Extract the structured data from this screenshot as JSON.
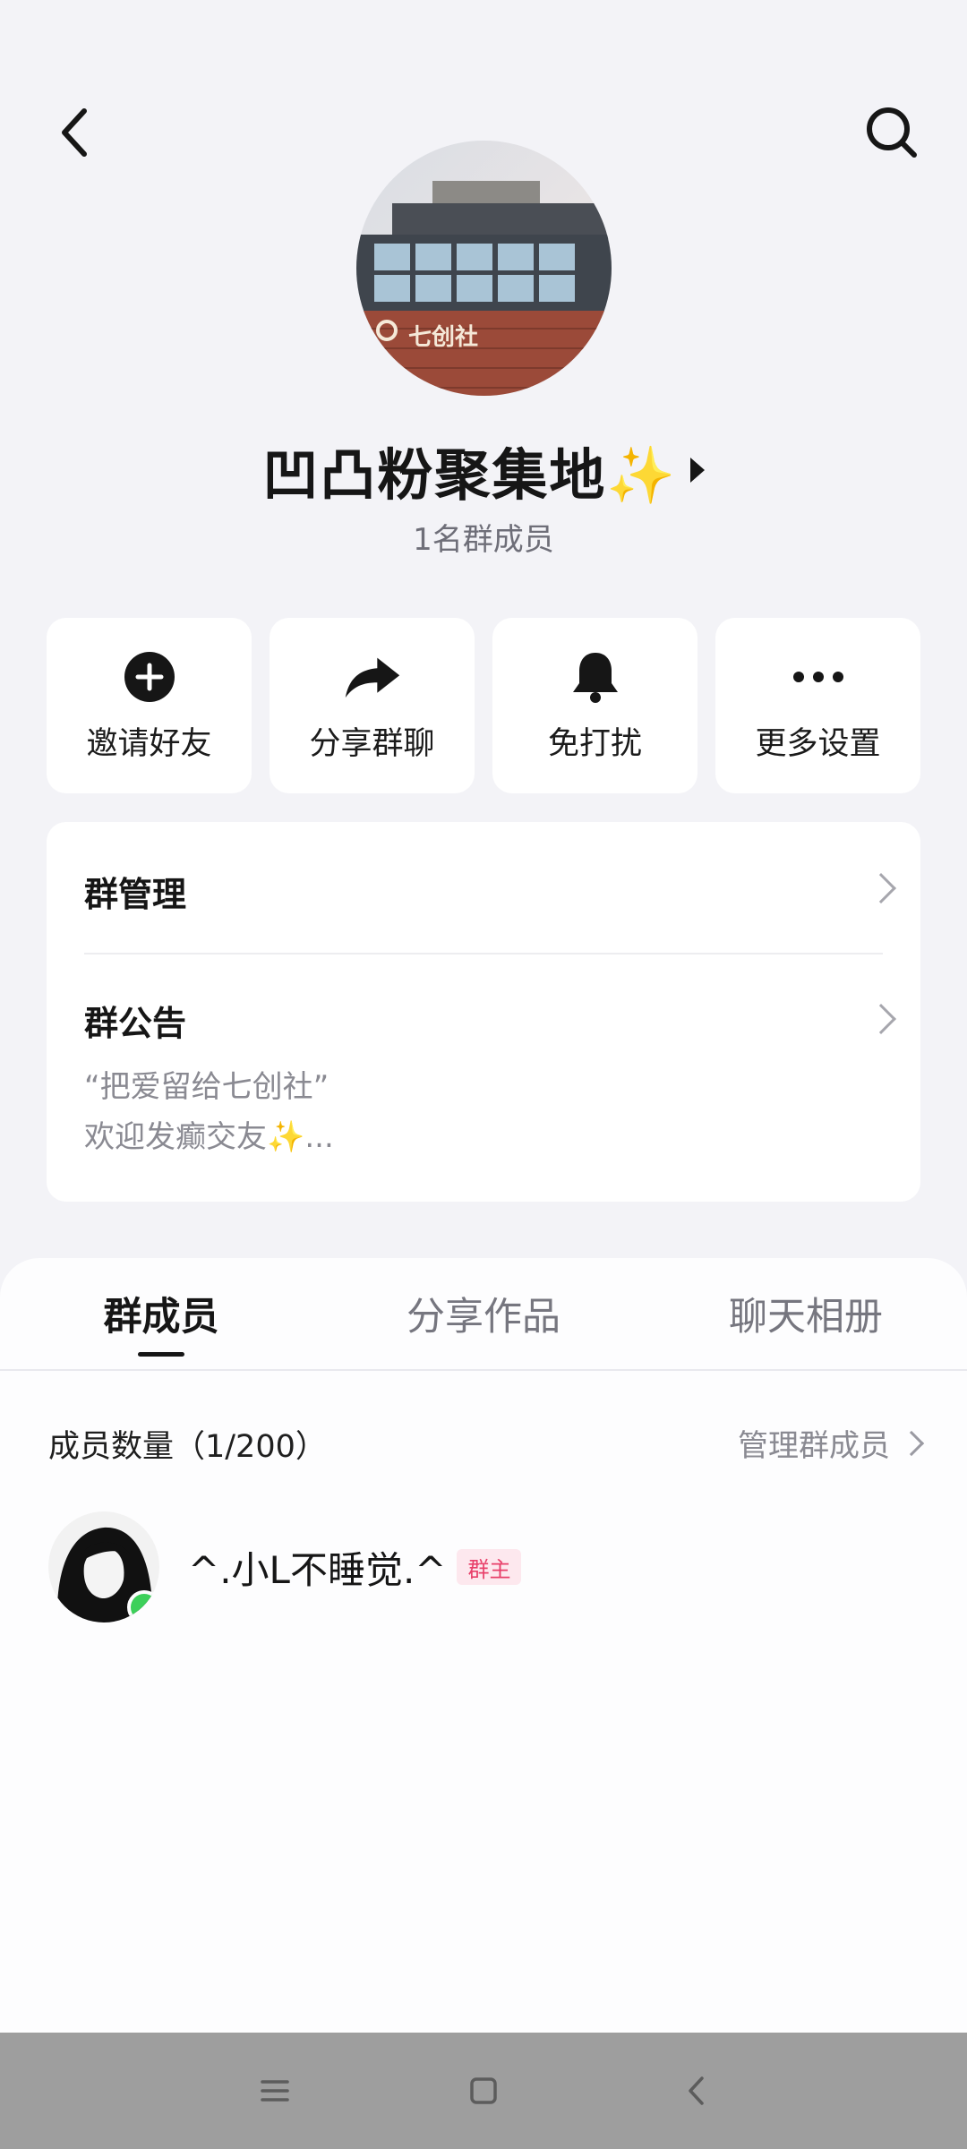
{
  "header": {
    "back_icon": "chevron-left-icon",
    "search_icon": "search-icon"
  },
  "group": {
    "avatar_sign_text": "七创社",
    "name": "凹凸粉聚集地✨",
    "member_count_text": "1名群成员"
  },
  "actions": [
    {
      "label": "邀请好友",
      "icon": "plus-circle-icon"
    },
    {
      "label": "分享群聊",
      "icon": "share-arrow-icon"
    },
    {
      "label": "免打扰",
      "icon": "bell-icon"
    },
    {
      "label": "更多设置",
      "icon": "more-dots-icon"
    }
  ],
  "management": {
    "group_manage_label": "群管理",
    "announcement_label": "群公告",
    "announcement_line1": "“把爱留给七创社”",
    "announcement_line2": "欢迎发癫交友✨..."
  },
  "tabs": [
    {
      "label": "群成员",
      "active": true
    },
    {
      "label": "分享作品",
      "active": false
    },
    {
      "label": "聊天相册",
      "active": false
    }
  ],
  "members": {
    "header_label": "成员数量（1/200）",
    "manage_label": "管理群成员",
    "list": [
      {
        "name": "^.小L不睡觉.^",
        "badge": "群主",
        "online": true
      }
    ]
  },
  "colors": {
    "background": "#f3f3f7",
    "card": "#ffffff",
    "online": "#3dd05a",
    "owner_badge_bg": "#fde8ee",
    "owner_badge_text": "#e8406a"
  }
}
